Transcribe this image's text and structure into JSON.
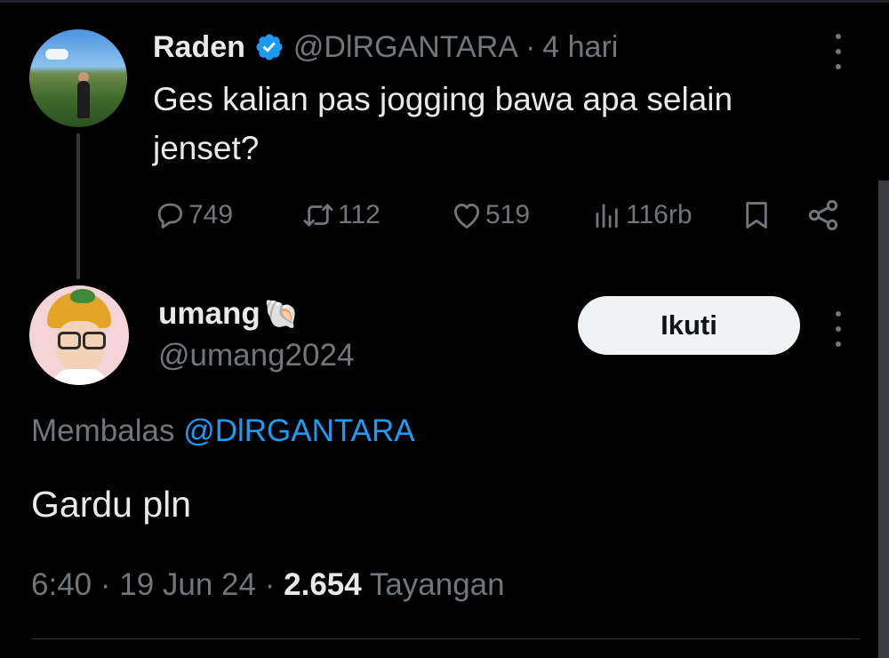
{
  "parent_tweet": {
    "display_name": "Raden",
    "handle": "@DlRGANTARA",
    "separator": "·",
    "time": "4 hari",
    "text": "Ges kalian pas jogging bawa apa selain jenset?",
    "stats": {
      "replies": "749",
      "retweets": "112",
      "likes": "519",
      "views": "116rb"
    },
    "icons": {
      "verified": "verified-badge-icon",
      "reply": "reply-icon",
      "retweet": "retweet-icon",
      "like": "heart-icon",
      "views": "views-chart-icon",
      "bookmark": "bookmark-icon",
      "share": "share-icon",
      "more": "more-vertical-icon"
    }
  },
  "reply_tweet": {
    "display_name": "umang",
    "name_emoji": "🐚",
    "handle": "@umang2024",
    "follow_label": "Ikuti",
    "replying_to_prefix": "Membalas",
    "replying_to_handle": "@DlRGANTARA",
    "text": "Gardu pln",
    "time": "6:40",
    "sep1": "·",
    "date": "19 Jun 24",
    "sep2": "·",
    "views_count": "2.654",
    "views_label": "Tayangan"
  },
  "colors": {
    "background": "#000000",
    "text_primary": "#e7e9ea",
    "text_secondary": "#71767b",
    "accent": "#1d9bf0",
    "button_bg": "#eff3f4"
  }
}
